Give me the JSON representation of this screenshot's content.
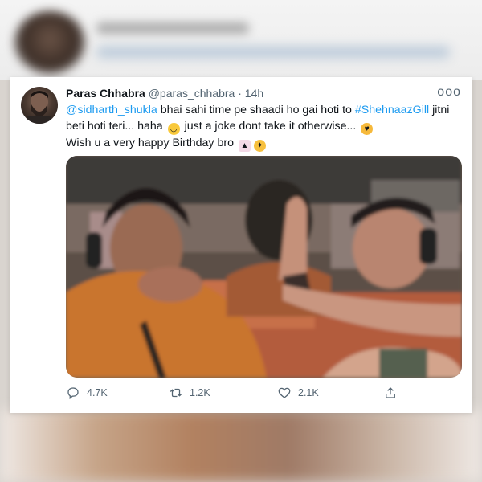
{
  "tweet": {
    "author_name": "Paras Chhabra",
    "handle": "@paras_chhabra",
    "separator": "·",
    "time": "14h",
    "more_label": "ooo",
    "line1_mention": "@sidharth_shukla",
    "line1_text": " bhai sahi time pe shaadi ho gai hoti to ",
    "line1_hashtag": "#ShehnaazGill",
    "line1_tail": " jitni",
    "line2_text": "beti hoti teri... haha",
    "line2_tail": "just a joke dont take it otherwise...",
    "line3_text": "Wish u a very happy Birthday bro",
    "emojis": [
      "grinning-face",
      "smiling-face-with-hearts",
      "birthday-cake",
      "partying-face"
    ]
  },
  "actions": {
    "reply_count": "4.7K",
    "retweet_count": "1.2K",
    "like_count": "2.1K"
  },
  "colors": {
    "link": "#1d9bf0",
    "text": "#0f1419",
    "secondary": "#536471"
  }
}
